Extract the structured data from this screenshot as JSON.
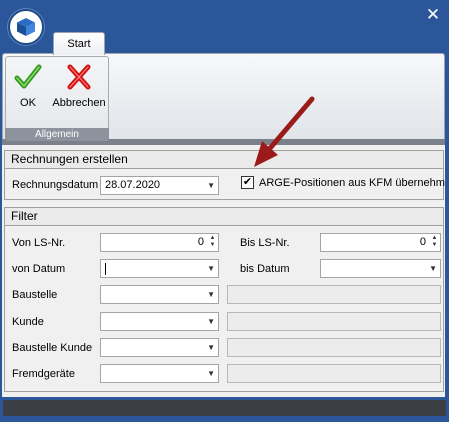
{
  "window": {
    "close_glyph": "✕"
  },
  "tabs": [
    {
      "label": "Start"
    }
  ],
  "ribbon": {
    "group_label": "Allgemein",
    "ok_label": "OK",
    "cancel_label": "Abbrechen"
  },
  "rechnungen": {
    "header": "Rechnungen erstellen",
    "datum_label": "Rechnungsdatum",
    "datum_value": "28.07.2020",
    "arge_label": "ARGE-Positionen aus KFM übernehm",
    "arge_checked": true
  },
  "filter": {
    "header": "Filter",
    "von_ls_label": "Von LS-Nr.",
    "von_ls_value": "0",
    "bis_ls_label": "Bis LS-Nr.",
    "bis_ls_value": "0",
    "von_datum_label": "von Datum",
    "von_datum_value": "",
    "bis_datum_label": "bis Datum",
    "bis_datum_value": "",
    "baustelle_label": "Baustelle",
    "kunde_label": "Kunde",
    "baustelle_kunde_label": "Baustelle Kunde",
    "fremdgeraete_label": "Fremdgeräte"
  },
  "colors": {
    "titlebar": "#2b579a",
    "arrow": "#9b1b1b",
    "ok": "#2e9a1e",
    "cancel": "#d01010"
  }
}
